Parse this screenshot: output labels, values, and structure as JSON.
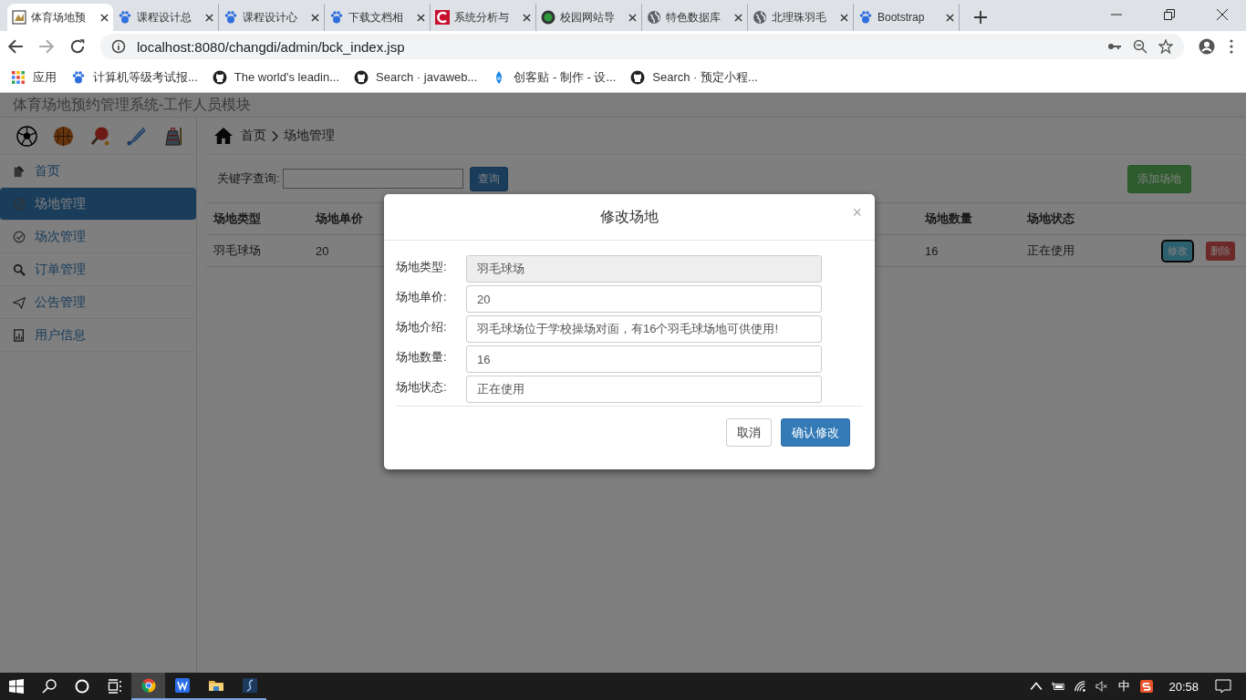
{
  "browser": {
    "tabs": [
      {
        "title": "体育场地预",
        "kind": "badge",
        "selected": true
      },
      {
        "title": "课程设计总",
        "kind": "paw",
        "selected": false
      },
      {
        "title": "课程设计心",
        "kind": "paw",
        "selected": false
      },
      {
        "title": "下载文档相",
        "kind": "paw",
        "selected": false
      },
      {
        "title": "系统分析与",
        "kind": "c",
        "selected": false
      },
      {
        "title": "校园网站导",
        "kind": "green",
        "selected": false
      },
      {
        "title": "特色数据库",
        "kind": "globe",
        "selected": false
      },
      {
        "title": "北理珠羽毛",
        "kind": "globe",
        "selected": false
      },
      {
        "title": "Bootstrap",
        "kind": "paw",
        "selected": false
      }
    ],
    "url": "localhost:8080/changdi/admin/bck_index.jsp",
    "bookmarks": [
      {
        "title": "应用",
        "kind": "apps"
      },
      {
        "title": "计算机等级考试报...",
        "kind": "paw"
      },
      {
        "title": "The world's leadin...",
        "kind": "github"
      },
      {
        "title": "Search · javaweb...",
        "kind": "github"
      },
      {
        "title": "创客贴 - 制作 - 设...",
        "kind": "drop"
      },
      {
        "title": "Search · 预定小程...",
        "kind": "github"
      }
    ]
  },
  "app": {
    "title": "体育场地预约管理系统-工作人员模块",
    "sidebar": {
      "items": [
        {
          "label": "首页",
          "kind": "doc",
          "selected": false
        },
        {
          "label": "场地管理",
          "kind": "check",
          "selected": true
        },
        {
          "label": "场次管理",
          "kind": "check",
          "selected": false
        },
        {
          "label": "订单管理",
          "kind": "search",
          "selected": false
        },
        {
          "label": "公告管理",
          "kind": "plane",
          "selected": false
        },
        {
          "label": "用户信息",
          "kind": "report",
          "selected": false
        }
      ]
    },
    "breadcrumb": [
      "首页",
      "场地管理"
    ],
    "search": {
      "label": "关键字查询:",
      "button": "查询"
    },
    "add_button": "添加场地",
    "table": {
      "columns": [
        "场地类型",
        "场地单价",
        "场地数量",
        "场地状态"
      ],
      "rows": [
        {
          "cells": [
            "羽毛球场",
            "20",
            "16",
            "正在使用"
          ],
          "actions": [
            "修改",
            "删除"
          ]
        }
      ]
    },
    "modal": {
      "title": "修改场地",
      "close": "×",
      "fields": [
        {
          "label": "场地类型:",
          "value": "羽毛球场",
          "disabled": true
        },
        {
          "label": "场地单价:",
          "value": "20",
          "disabled": false
        },
        {
          "label": "场地介绍:",
          "value": "羽毛球场位于学校操场对面，有16个羽毛球场地可供使用!",
          "disabled": false
        },
        {
          "label": "场地数量:",
          "value": "16",
          "disabled": false
        },
        {
          "label": "场地状态:",
          "value": "正在使用",
          "disabled": false
        }
      ],
      "buttons": [
        {
          "label": "取消",
          "kind": "default"
        },
        {
          "label": "确认修改",
          "kind": "primary"
        }
      ]
    }
  },
  "taskbar": {
    "apps": [
      {
        "kind": "chrome",
        "selected": true
      },
      {
        "kind": "wps",
        "selected": false
      },
      {
        "kind": "folder",
        "selected": false
      },
      {
        "kind": "pen",
        "selected": false
      }
    ],
    "ime": "中",
    "time": "20:58"
  }
}
